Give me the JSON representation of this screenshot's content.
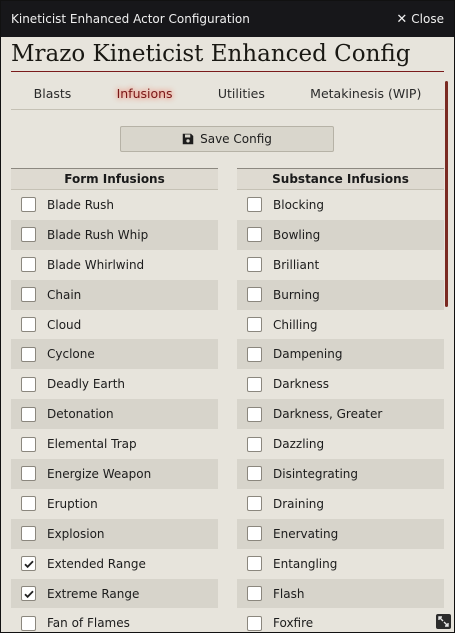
{
  "window": {
    "title": "Kineticist Enhanced Actor Configuration",
    "close_label": "Close"
  },
  "config_title": "Mrazo Kineticist Enhanced Config",
  "tabs": [
    {
      "label": "Blasts",
      "active": false
    },
    {
      "label": "Infusions",
      "active": true
    },
    {
      "label": "Utilities",
      "active": false
    },
    {
      "label": "Metakinesis (WIP)",
      "active": false
    }
  ],
  "save_label": "Save Config",
  "columns": {
    "form": {
      "header": "Form Infusions",
      "items": [
        {
          "label": "Blade Rush",
          "checked": false
        },
        {
          "label": "Blade Rush Whip",
          "checked": false
        },
        {
          "label": "Blade Whirlwind",
          "checked": false
        },
        {
          "label": "Chain",
          "checked": false
        },
        {
          "label": "Cloud",
          "checked": false
        },
        {
          "label": "Cyclone",
          "checked": false
        },
        {
          "label": "Deadly Earth",
          "checked": false
        },
        {
          "label": "Detonation",
          "checked": false
        },
        {
          "label": "Elemental Trap",
          "checked": false
        },
        {
          "label": "Energize Weapon",
          "checked": false
        },
        {
          "label": "Eruption",
          "checked": false
        },
        {
          "label": "Explosion",
          "checked": false
        },
        {
          "label": "Extended Range",
          "checked": true
        },
        {
          "label": "Extreme Range",
          "checked": true
        },
        {
          "label": "Fan of Flames",
          "checked": false
        }
      ]
    },
    "substance": {
      "header": "Substance Infusions",
      "items": [
        {
          "label": "Blocking",
          "checked": false
        },
        {
          "label": "Bowling",
          "checked": false
        },
        {
          "label": "Brilliant",
          "checked": false
        },
        {
          "label": "Burning",
          "checked": false
        },
        {
          "label": "Chilling",
          "checked": false
        },
        {
          "label": "Dampening",
          "checked": false
        },
        {
          "label": "Darkness",
          "checked": false
        },
        {
          "label": "Darkness, Greater",
          "checked": false
        },
        {
          "label": "Dazzling",
          "checked": false
        },
        {
          "label": "Disintegrating",
          "checked": false
        },
        {
          "label": "Draining",
          "checked": false
        },
        {
          "label": "Enervating",
          "checked": false
        },
        {
          "label": "Entangling",
          "checked": false
        },
        {
          "label": "Flash",
          "checked": false
        },
        {
          "label": "Foxfire",
          "checked": false
        }
      ]
    }
  },
  "colors": {
    "accent": "#7a1616",
    "titlebar": "#17171a",
    "panel": "#e7e4dc"
  },
  "icons": {
    "save": "floppy-disk-icon",
    "close": "close-icon",
    "resize": "resize-icon"
  }
}
